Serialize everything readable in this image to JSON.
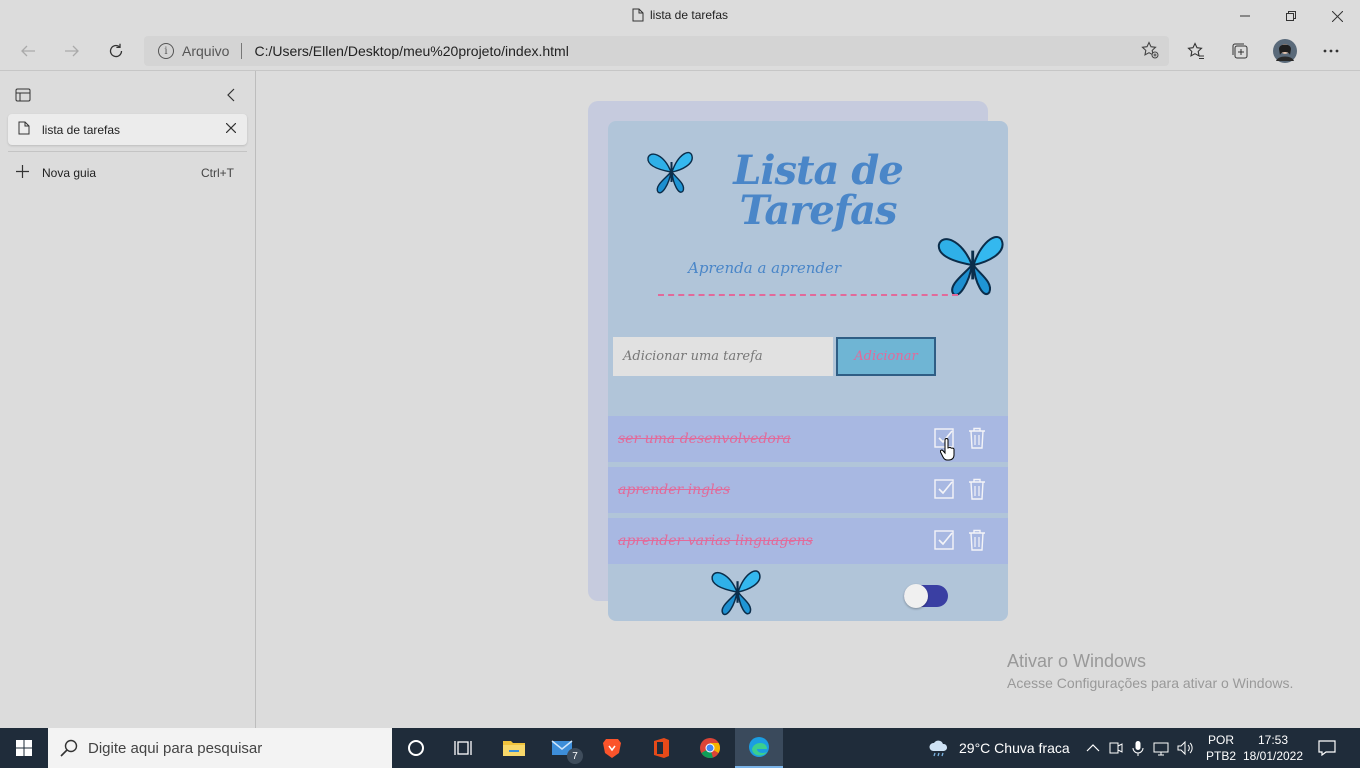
{
  "window": {
    "title": "lista de tarefas",
    "minimize_icon": "minimize-icon",
    "restore_icon": "restore-icon",
    "close_icon": "close-icon"
  },
  "navbar": {
    "security_label": "Arquivo",
    "url": "C:/Users/Ellen/Desktop/meu%20projeto/index.html"
  },
  "sidebar": {
    "tabs": [
      {
        "label": "lista de tarefas"
      }
    ],
    "new_tab_label": "Nova guia",
    "new_tab_shortcut": "Ctrl+T"
  },
  "page": {
    "title_line1": "Lista de",
    "title_line2": "Tarefas",
    "subtitle": "Aprenda a aprender",
    "input_placeholder": "Adicionar uma tarefa",
    "add_button": "Adicionar",
    "tasks": [
      {
        "text": "ser uma desenvolvedora",
        "done": true
      },
      {
        "text": "aprender ingles",
        "done": true
      },
      {
        "text": "aprender varias linguagens",
        "done": true
      }
    ],
    "theme_toggle_on": true
  },
  "watermark": {
    "line1": "Ativar o Windows",
    "line2": "Acesse Configurações para ativar o Windows."
  },
  "taskbar": {
    "search_placeholder": "Digite aqui para pesquisar",
    "mail_badge": "7",
    "weather": "29°C  Chuva fraca",
    "language_line1": "POR",
    "language_line2": "PTB2",
    "time": "17:53",
    "date": "18/01/2022"
  },
  "colors": {
    "card": "#b1c5d9",
    "title": "#4a86c8",
    "accent_pink": "#e26a9a",
    "task_row": "#a8b8e2",
    "toggle": "#3a3fa3"
  }
}
